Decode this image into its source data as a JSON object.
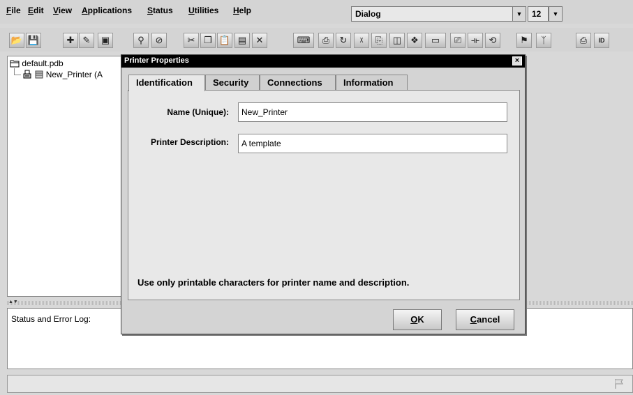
{
  "menubar": {
    "items": [
      {
        "label": "File",
        "mnemonic": "F",
        "rest": "ile"
      },
      {
        "label": "Edit",
        "mnemonic": "E",
        "rest": "dit"
      },
      {
        "label": "View",
        "mnemonic": "V",
        "rest": "iew"
      },
      {
        "label": "Applications",
        "mnemonic": "A",
        "rest": "pplications"
      },
      {
        "label": "Status",
        "mnemonic": "S",
        "rest": "tatus"
      },
      {
        "label": "Utilities",
        "mnemonic": "U",
        "rest": "tilities"
      },
      {
        "label": "Help",
        "mnemonic": "H",
        "rest": "elp"
      }
    ],
    "font_combo": "Dialog",
    "size_combo": "12"
  },
  "toolbar": {
    "icons": [
      "open-icon",
      "save-icon",
      "new-printer-icon",
      "new-job-icon",
      "new-device-icon",
      "find-icon",
      "cancel-icon",
      "cut-icon",
      "copy-icon",
      "paste-icon",
      "paste-special-icon",
      "delete-icon",
      "keyboard-icon",
      "printer-icon",
      "refresh-icon",
      "xy-icon",
      "printer-add-icon",
      "device-icon",
      "print-jobs-icon",
      "card-icon",
      "printer-queue-icon",
      "split-icon",
      "reload-icon",
      "flag-icon",
      "antenna-icon",
      "printer-status-icon",
      "id-icon"
    ]
  },
  "tree": {
    "root": "default.pdb",
    "child": "New_Printer (A"
  },
  "status": {
    "log_label": "Status and Error Log:"
  },
  "dialog": {
    "title": "Printer Properties",
    "tabs": [
      "Identification",
      "Security",
      "Connections",
      "Information"
    ],
    "active_tab": "Identification",
    "name_label": "Name (Unique):",
    "name_value": "New_Printer",
    "desc_label": "Printer Description:",
    "desc_value": "A template",
    "hint": "Use only printable characters for printer name and description.",
    "ok": {
      "mnemonic": "O",
      "rest": "K"
    },
    "cancel": {
      "mnemonic": "C",
      "rest": "ancel"
    }
  }
}
